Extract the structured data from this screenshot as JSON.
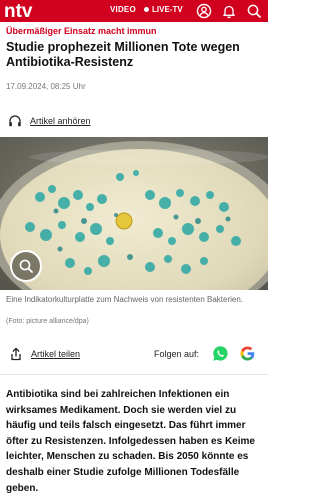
{
  "header": {
    "brand": "ntv",
    "nav_video": "VIDEO",
    "nav_live": "LIVE-TV",
    "icons": [
      "user-icon",
      "bell-icon",
      "search-icon"
    ],
    "brand_color": "#d1001f"
  },
  "article": {
    "kicker": "Übermäßiger Einsatz macht immun",
    "headline": "Studie prophezeit Millionen Tote wegen Antibiotika-Resistenz",
    "date": "17.09.2024, 08:25 Uhr",
    "listen_label": "Artikel anhören",
    "image": {
      "caption": "Eine Indikatorkulturplatte zum Nachweis von resistenten Bakterien.",
      "credit": "(Foto: picture alliance/dpa)"
    },
    "share_label": "Artikel teilen",
    "follow_label": "Folgen auf:",
    "lead": "Antibiotika sind bei zahlreichen Infektionen ein wirksames Medikament. Doch sie werden viel zu häufig und teils falsch eingesetzt. Das führt immer öfter zu Resistenzen. Infolgedessen haben es Keime leichter, Menschen zu schaden. Bis 2050 könnte es deshalb einer Studie zufolge Millionen Todesfälle geben."
  }
}
